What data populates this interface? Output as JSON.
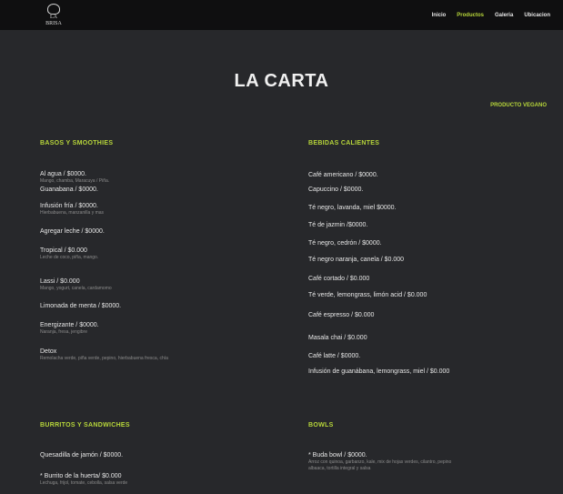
{
  "header": {
    "logo_text": "LA BRISA",
    "nav": [
      "Inicio",
      "Productos",
      "Galeria",
      "Ubicacion"
    ],
    "active_index": 1
  },
  "page": {
    "title": "LA CARTA",
    "veg_link": "PRODUCTO VEGANO"
  },
  "sections": {
    "left_top": {
      "title": "BASOS Y SMOOTHIES",
      "items": [
        {
          "name": "Al agua / $0000.",
          "desc": "Mango, chamba, Maracuya / Piña."
        },
        {
          "name": "Guanabana / $0000.",
          "desc": ""
        },
        {
          "name": "Infusión fría / $0000.",
          "desc": "Hierbabuena, manzanilla y mas"
        },
        {
          "name": "Agregar leche / $0000.",
          "desc": ""
        },
        {
          "name": "Tropical / $0.000",
          "desc": "Leche de coco, piña, mango."
        },
        {
          "name": "Lassi / $0.000",
          "desc": "Mango, yogurt, canela, cardamomo"
        },
        {
          "name": "Limonada de menta / $0000.",
          "desc": ""
        },
        {
          "name": "Energizante / $0000.",
          "desc": "Naranja, fresa, jengibre"
        },
        {
          "name": "Detox",
          "desc": "Remolacha verde, piña verde, pepino, hierbabuena fresca, chía"
        }
      ]
    },
    "right_top": {
      "title": "BEBIDAS CALIENTES",
      "items": [
        {
          "name": "Café americano / $0000."
        },
        {
          "name": "Capuccino / $0000."
        },
        {
          "name": "Té negro, lavanda, miel $0000."
        },
        {
          "name": "Té de jazmin /$0000."
        },
        {
          "name": "Té negro, cedrón / $0000."
        },
        {
          "name": "Té negro naranja, canela / $0.000"
        },
        {
          "name": "Café cortado / $0.000"
        },
        {
          "name": "Té verde, lemongrass, limón acid / $0.000"
        },
        {
          "name": "Café espresso / $0.000"
        },
        {
          "name": "Masala chai / $0.000"
        },
        {
          "name": "Café latte / $0000."
        },
        {
          "name": "Infusión de guanábana, lemongrass, miel / $0.000"
        }
      ]
    },
    "left_bottom": {
      "title": "BURRITOS Y SANDWICHES",
      "items": [
        {
          "name": "Quesadilla de jamón / $0000.",
          "desc": ""
        },
        {
          "name": "* Burrito de la huerta/ $0.000",
          "desc": "Lechuga, frijol, tomate, cebolla, salsa verde"
        }
      ]
    },
    "right_bottom": {
      "title": "BOWLS",
      "items": [
        {
          "name": "* Buda bowl / $0000.",
          "desc": "Arroz con quinoa, garbanzo, kale, mix de hojas verdes, cilantro, pepino",
          "desc2": "albaaca, tortilla integral y salsa"
        }
      ]
    }
  }
}
